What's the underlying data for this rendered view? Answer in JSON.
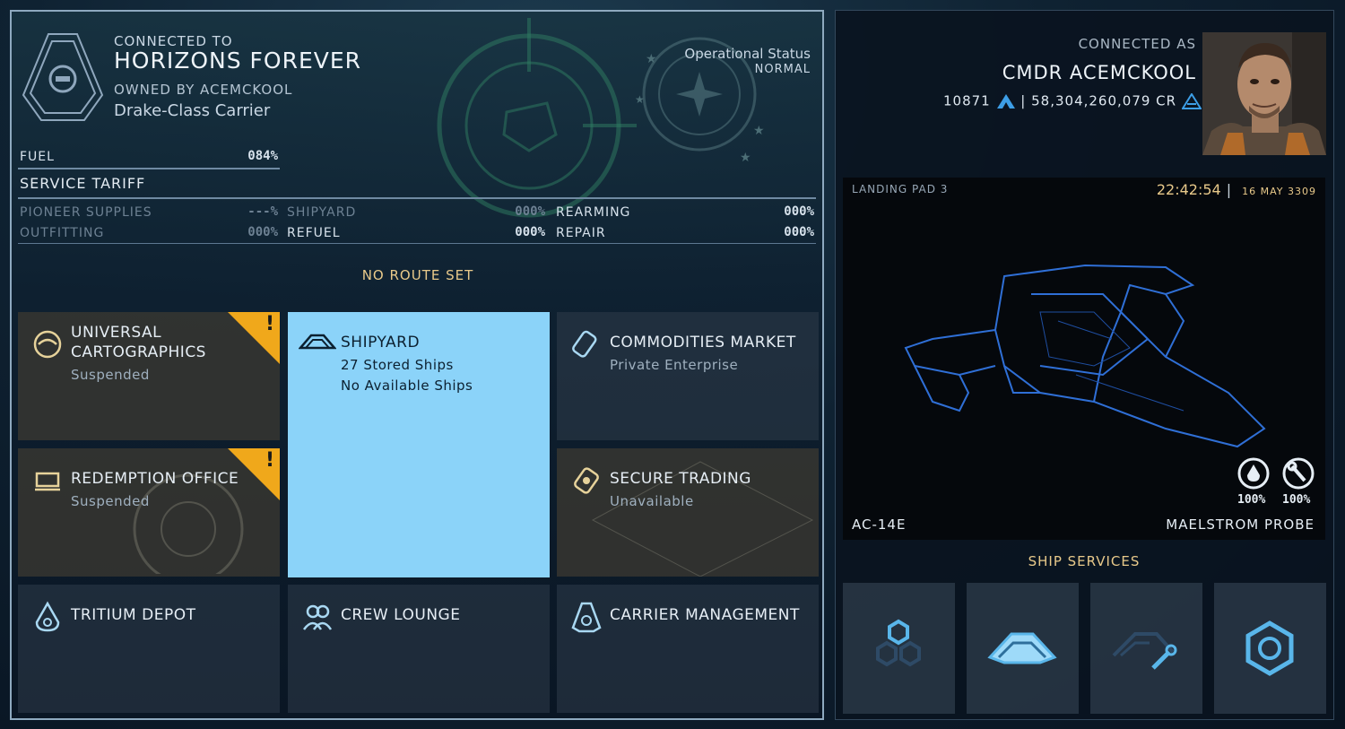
{
  "carrier": {
    "connected_label": "CONNECTED TO",
    "name": "HORIZONS FOREVER",
    "owner": "OWNED BY ACEMCKOOL",
    "class": "Drake-Class Carrier",
    "operational_status_label": "Operational Status",
    "operational_status_value": "NORMAL"
  },
  "fuel": {
    "label": "FUEL",
    "value": "084%"
  },
  "tariff": {
    "title": "SERVICE TARIFF",
    "items": [
      {
        "label": "PIONEER SUPPLIES",
        "value": "---%"
      },
      {
        "label": "OUTFITTING",
        "value": "000%"
      },
      {
        "label": "SHIPYARD",
        "value": "000%"
      },
      {
        "label": "REFUEL",
        "value": "000%"
      },
      {
        "label": "REARMING",
        "value": "000%"
      },
      {
        "label": "REPAIR",
        "value": "000%"
      }
    ]
  },
  "route": "NO ROUTE SET",
  "tiles": {
    "cartographics": {
      "title": "UNIVERSAL CARTOGRAPHICS",
      "sub": "Suspended",
      "warning": "!"
    },
    "shipyard": {
      "title": "SHIPYARD",
      "line1": "27 Stored Ships",
      "line2": "No Available Ships"
    },
    "commodities": {
      "title": "COMMODITIES MARKET",
      "sub": "Private Enterprise"
    },
    "redemption": {
      "title": "REDEMPTION OFFICE",
      "sub": "Suspended",
      "warning": "!"
    },
    "secure_trading": {
      "title": "SECURE TRADING",
      "sub": "Unavailable"
    },
    "tritium": {
      "title": "TRITIUM DEPOT"
    },
    "crew": {
      "title": "CREW LOUNGE"
    },
    "management": {
      "title": "CARRIER MANAGEMENT"
    }
  },
  "commander": {
    "connected_label": "CONNECTED AS",
    "name": "CMDR ACEMCKOOL",
    "rank_value": "10871",
    "credits": "58,304,260,079 CR"
  },
  "landing": {
    "pad": "LANDING PAD 3",
    "time": "22:42:54",
    "date": "16 MAY 3309",
    "ship_id": "AC-14E",
    "ship_name": "MAELSTROM PROBE",
    "fuel_pct": "100%",
    "hull_pct": "100%"
  },
  "ship_services": {
    "title": "SHIP SERVICES"
  },
  "colors": {
    "accent_orange": "#e8c98a",
    "warning": "#f0a81b",
    "selected_tile": "#8bd3f9",
    "icon_blue": "#59b6ea"
  },
  "icons": [
    "carrier-emblem-icon",
    "cartographics-icon",
    "shipyard-icon",
    "commodities-icon",
    "redemption-icon",
    "secure-trading-icon",
    "tritium-icon",
    "crew-icon",
    "carrier-management-icon",
    "fuel-drop-icon",
    "wrench-icon",
    "engineering-hex-icon",
    "hangar-ship-icon",
    "outfitting-icon",
    "hex-settings-icon"
  ]
}
